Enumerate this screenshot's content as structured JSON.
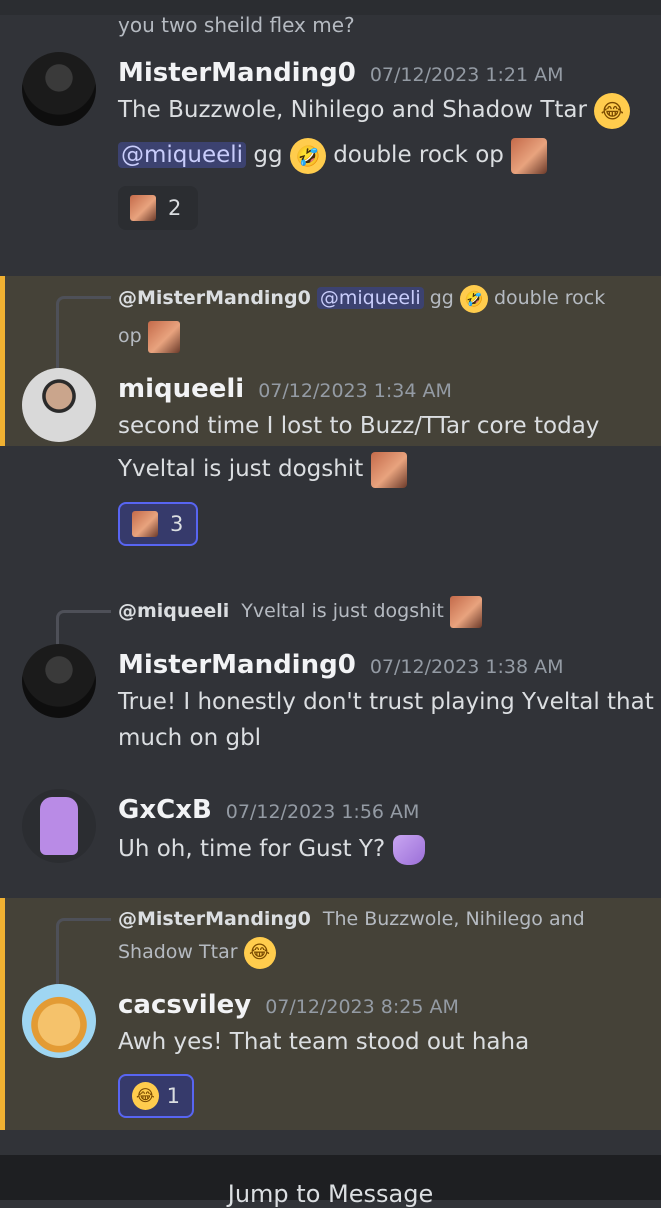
{
  "top_text": "you two sheild flex me?",
  "messages": [
    {
      "author": "MisterManding0",
      "time": "07/12/2023 1:21 AM",
      "line1": "The Buzzwole, Nihilego and Shadow Ttar",
      "line2_mention": "@miqueeli",
      "line2_a": "gg",
      "line2_b": "double rock op",
      "reaction_count": "2"
    },
    {
      "reply_user": "@MisterManding0",
      "reply_mention": "@miqueeli",
      "reply_a": "gg",
      "reply_b": "double rock",
      "reply_c": "op",
      "author": "miqueeli",
      "time": "07/12/2023 1:34 AM",
      "line1": "second time I lost to Buzz/TTar core today",
      "line2": "Yveltal is just dogshit",
      "reaction_count": "3"
    },
    {
      "reply_user": "@miqueeli",
      "reply_text": "Yveltal is just dogshit",
      "author": "MisterManding0",
      "time": "07/12/2023 1:38 AM",
      "line1": "True! I honestly don't trust playing Yveltal that",
      "line2": "much on gbl"
    },
    {
      "author": "GxCxB",
      "time": "07/12/2023 1:56 AM",
      "line1": "Uh oh, time for Gust Y?"
    },
    {
      "reply_user": "@MisterManding0",
      "reply_text": "The Buzzwole, Nihilego and",
      "reply_text2": "Shadow Ttar",
      "author": "cacsviley",
      "time": "07/12/2023 8:25 AM",
      "line1": "Awh yes! That team stood out haha",
      "reaction_count": "1"
    }
  ],
  "jump_label": "Jump to Message",
  "icons": {
    "laugh": "joy-emoji",
    "rofl": "rolling-on-floor-laughing-emoji",
    "custom": "custom-face-emoji",
    "gust": "custom-purple-emoji"
  },
  "colors": {
    "background": "#313338",
    "highlight": "#454238",
    "highlight_bar": "#f0b132",
    "mention_bg": "#3c4270",
    "reaction_me_border": "#5865f2"
  }
}
